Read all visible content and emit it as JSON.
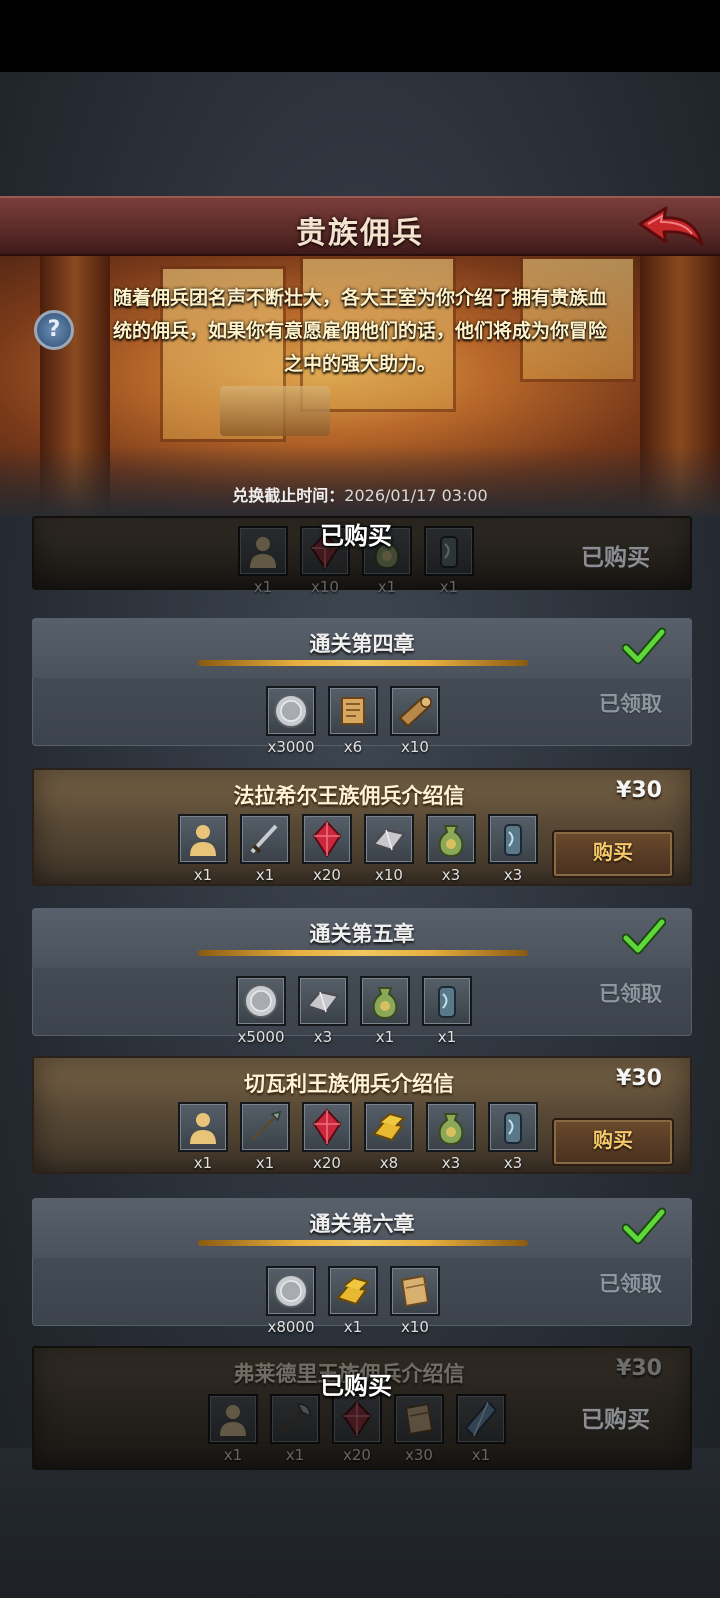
{
  "header": {
    "title": "贵族佣兵",
    "back_icon": "back-arrow-icon"
  },
  "banner": {
    "description": "随着佣兵团名声不断壮大，各大王室为你介绍了拥有贵族血统的佣兵，如果你有意愿雇佣他们的话，他们将成为你冒险之中的强大助力。",
    "help_icon": "?",
    "deadline_label": "兑换截止时间：",
    "deadline_value": "2026/01/17 03:00"
  },
  "accent_colors": {
    "header": "#5a2a28",
    "gold": "#f7c96b",
    "check": "#5fd63a"
  },
  "cards": [
    {
      "type": "offer",
      "state": "purchased",
      "partial": true,
      "status_center": "已购买",
      "status_right": "已购买",
      "items": [
        {
          "icon": "mercenary-icon",
          "qty": "x1"
        },
        {
          "icon": "red-crystal-icon",
          "qty": "x10"
        },
        {
          "icon": "potion-bag-icon",
          "qty": "x1"
        },
        {
          "icon": "lantern-icon",
          "qty": "x1"
        }
      ]
    },
    {
      "type": "milestone",
      "title": "通关第四章",
      "status": "已领取",
      "completed": true,
      "items": [
        {
          "icon": "silver-coin-icon",
          "qty": "x3000"
        },
        {
          "icon": "scroll-icon",
          "qty": "x6"
        },
        {
          "icon": "wood-log-icon",
          "qty": "x10"
        }
      ]
    },
    {
      "type": "offer",
      "state": "available",
      "title": "法拉希尔王族佣兵介绍信",
      "price": "¥30",
      "button": "购买",
      "items": [
        {
          "icon": "mercenary-icon",
          "qty": "x1"
        },
        {
          "icon": "sword-icon",
          "qty": "x1"
        },
        {
          "icon": "red-crystal-icon",
          "qty": "x20"
        },
        {
          "icon": "iron-ingot-icon",
          "qty": "x10"
        },
        {
          "icon": "potion-bag-icon",
          "qty": "x3"
        },
        {
          "icon": "lantern-icon",
          "qty": "x3"
        }
      ]
    },
    {
      "type": "milestone",
      "title": "通关第五章",
      "status": "已领取",
      "completed": true,
      "items": [
        {
          "icon": "silver-coin-icon",
          "qty": "x5000"
        },
        {
          "icon": "iron-ingot-icon",
          "qty": "x3"
        },
        {
          "icon": "potion-bag-icon",
          "qty": "x1"
        },
        {
          "icon": "lantern-icon",
          "qty": "x1"
        }
      ]
    },
    {
      "type": "offer",
      "state": "available",
      "title": "切瓦利王族佣兵介绍信",
      "price": "¥30",
      "button": "购买",
      "items": [
        {
          "icon": "mercenary-icon",
          "qty": "x1"
        },
        {
          "icon": "spear-icon",
          "qty": "x1"
        },
        {
          "icon": "red-crystal-icon",
          "qty": "x20"
        },
        {
          "icon": "gold-bar-icon",
          "qty": "x8"
        },
        {
          "icon": "potion-bag-icon",
          "qty": "x3"
        },
        {
          "icon": "lantern-icon",
          "qty": "x3"
        }
      ]
    },
    {
      "type": "milestone",
      "title": "通关第六章",
      "status": "已领取",
      "completed": true,
      "items": [
        {
          "icon": "silver-coin-icon",
          "qty": "x8000"
        },
        {
          "icon": "gold-bar-icon",
          "qty": "x1"
        },
        {
          "icon": "leather-icon",
          "qty": "x10"
        }
      ]
    },
    {
      "type": "offer",
      "state": "purchased",
      "title": "弗莱德里王族佣兵介绍信",
      "price": "¥30",
      "status_center": "已购买",
      "status_right": "已购买",
      "items": [
        {
          "icon": "mercenary-icon",
          "qty": "x1"
        },
        {
          "icon": "axe-icon",
          "qty": "x1"
        },
        {
          "icon": "red-crystal-icon",
          "qty": "x20"
        },
        {
          "icon": "leather-icon",
          "qty": "x30"
        },
        {
          "icon": "blue-crystal-icon",
          "qty": "x1"
        }
      ]
    }
  ]
}
